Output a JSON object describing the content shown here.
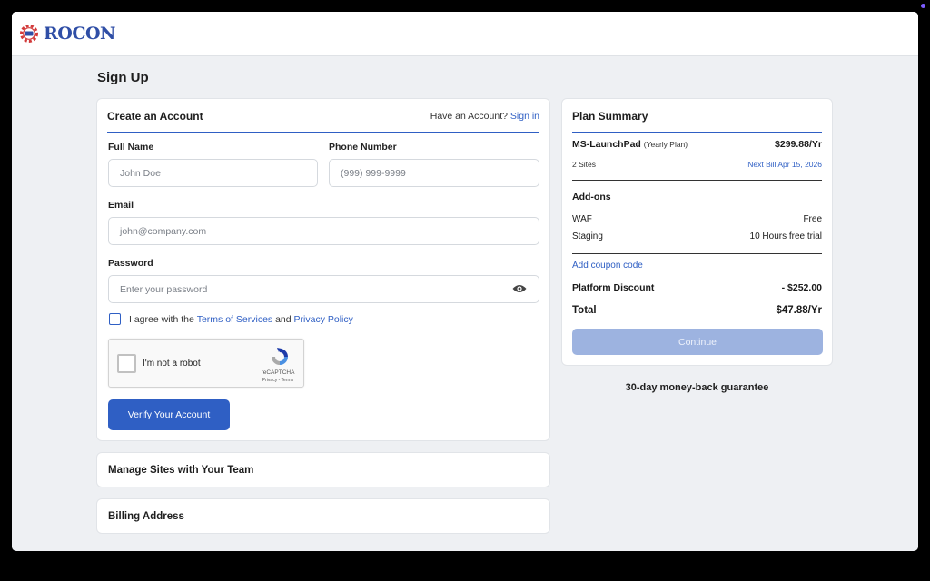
{
  "brand": {
    "name": "ROCON"
  },
  "page": {
    "title": "Sign Up"
  },
  "account": {
    "title": "Create an Account",
    "have_account": "Have an Account?",
    "sign_in": "Sign in",
    "full_name": {
      "label": "Full Name",
      "placeholder": "John Doe"
    },
    "phone": {
      "label": "Phone Number",
      "placeholder": "(999) 999-9999"
    },
    "email": {
      "label": "Email",
      "placeholder": "john@company.com"
    },
    "password": {
      "label": "Password",
      "placeholder": "Enter your password"
    },
    "agree_prefix": "I agree with the",
    "terms": "Terms of Services",
    "and": "and",
    "privacy": "Privacy Policy",
    "recaptcha": {
      "label": "I'm not a robot",
      "brand": "reCAPTCHA",
      "links": "Privacy - Terms"
    },
    "verify": "Verify Your Account"
  },
  "sections": {
    "manage": "Manage Sites with Your Team",
    "billing": "Billing Address"
  },
  "plan": {
    "title": "Plan Summary",
    "name": "MS-LaunchPad",
    "period": "(Yearly Plan)",
    "price": "$299.88/Yr",
    "sites": "2 Sites",
    "next_bill": "Next Bill Apr 15, 2026",
    "addons_title": "Add-ons",
    "addons": [
      {
        "name": "WAF",
        "value": "Free"
      },
      {
        "name": "Staging",
        "value": "10 Hours free trial"
      }
    ],
    "coupon": "Add coupon code",
    "discount_label": "Platform Discount",
    "discount_value": "- $252.00",
    "total_label": "Total",
    "total_value": "$47.88/Yr",
    "continue": "Continue"
  },
  "guarantee": "30-day money-back guarantee",
  "colors": {
    "accent": "#2f5fc4",
    "brand_red": "#d23a3a",
    "background": "#eef0f3"
  }
}
